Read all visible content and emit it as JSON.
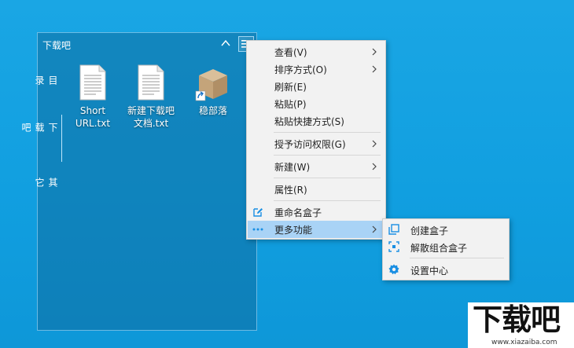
{
  "fence": {
    "title": "下载吧",
    "tabs": [
      "目录",
      "下载吧",
      "其它"
    ],
    "files": [
      {
        "name": "Short URL.txt",
        "icon": "text-file-icon"
      },
      {
        "name": "新建下载吧文档.txt",
        "icon": "text-file-icon"
      },
      {
        "name": "稳部落",
        "icon": "package-box-shortcut-icon"
      }
    ]
  },
  "context_menu": {
    "items": [
      {
        "label": "查看(V)",
        "has_submenu": true
      },
      {
        "label": "排序方式(O)",
        "has_submenu": true
      },
      {
        "label": "刷新(E)",
        "has_submenu": false
      },
      {
        "label": "粘贴(P)",
        "has_submenu": false
      },
      {
        "label": "粘贴快捷方式(S)",
        "has_submenu": false
      },
      {
        "label": "授予访问权限(G)",
        "has_submenu": true
      },
      {
        "label": "新建(W)",
        "has_submenu": true
      },
      {
        "label": "属性(R)",
        "has_submenu": false
      },
      {
        "label": "重命名盒子",
        "has_submenu": false,
        "icon": "edit-icon"
      },
      {
        "label": "更多功能",
        "has_submenu": true,
        "icon": "more-dots-icon",
        "highlighted": true
      }
    ]
  },
  "submenu": {
    "items": [
      {
        "label": "创建盒子",
        "icon": "create-box-icon"
      },
      {
        "label": "解散组合盒子",
        "icon": "ungroup-icon"
      },
      {
        "label": "设置中心",
        "icon": "gear-icon"
      }
    ]
  },
  "watermark": {
    "logo_text": "下载吧",
    "url": "www.xiazaiba.com"
  },
  "colors": {
    "desktop": "#119fe0",
    "accent": "#1a8fe3",
    "menu_highlight": "#a9d3f6",
    "menu_bg": "#f2f2f2"
  }
}
